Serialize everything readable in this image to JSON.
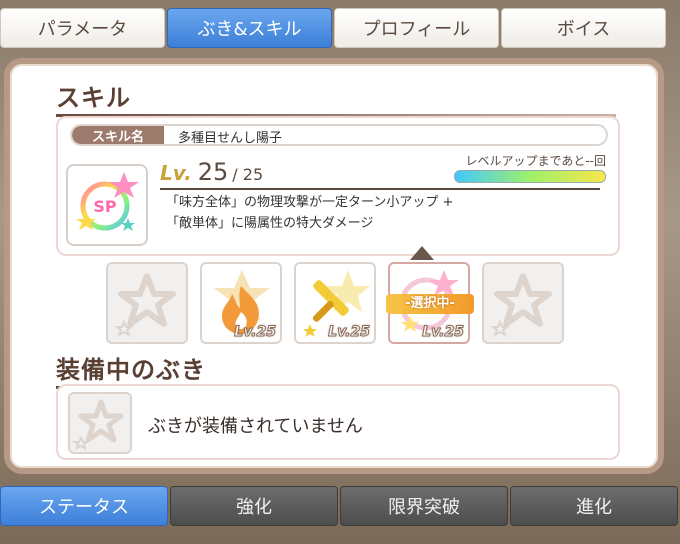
{
  "top_tabs": [
    "パラメータ",
    "ぶき&スキル",
    "プロフィール",
    "ボイス"
  ],
  "skill_section": {
    "title": "スキル",
    "name_label": "スキル名",
    "name_value": "多種目せんし陽子",
    "icon_text": "SP",
    "lv_label": "Lv.",
    "lv_value": "25",
    "lv_max": "/ 25",
    "levelup_text": "レベルアップまであと--回",
    "desc_line1": "「味方全体」の物理攻撃が一定ターン小アップ +",
    "desc_line2": "「敵単体」に陽属性の特大ダメージ"
  },
  "skill_slots": [
    {
      "icon": "empty-star-icon",
      "level": ""
    },
    {
      "icon": "fire-icon",
      "level": "Lv.25"
    },
    {
      "icon": "sword-icon",
      "level": "Lv.25"
    },
    {
      "icon": "sp-star-icon",
      "level": "Lv.25",
      "badge": "-選択中-"
    },
    {
      "icon": "empty-star-icon",
      "level": ""
    }
  ],
  "equip_section": {
    "title": "装備中のぶき",
    "empty_text": "ぶきが装備されていません"
  },
  "bottom_tabs": [
    "ステータス",
    "強化",
    "限界突破",
    "進化"
  ],
  "colors": {
    "active_tab": "#3d7fd9",
    "frame": "#b79a86",
    "heading": "#5a3f33"
  }
}
